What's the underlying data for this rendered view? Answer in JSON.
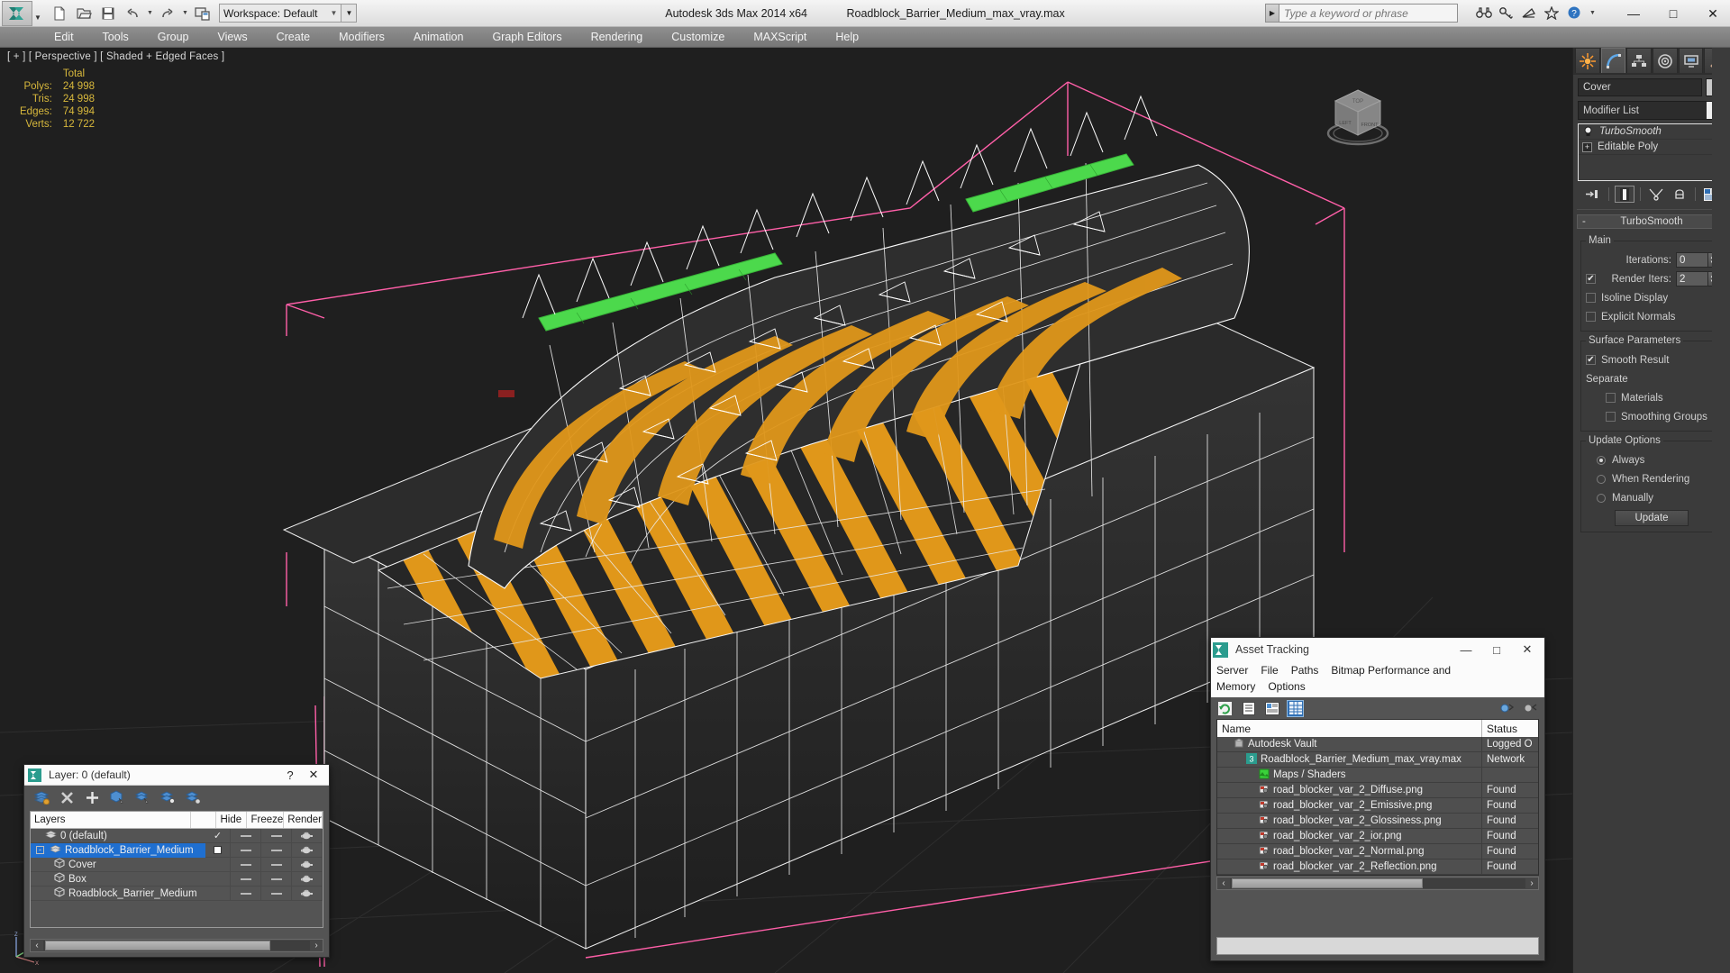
{
  "titlebar": {
    "app_name": "Autodesk 3ds Max  2014 x64",
    "file_name": "Roadblock_Barrier_Medium_max_vray.max",
    "workspace_label": "Workspace: Default",
    "search_placeholder": "Type a keyword or phrase",
    "minimize": "—",
    "maximize": "□",
    "close": "✕",
    "quick_access": [
      {
        "name": "new-scene-icon"
      },
      {
        "name": "open-file-icon"
      },
      {
        "name": "save-file-icon"
      },
      {
        "name": "undo-icon"
      },
      {
        "name": "redo-icon"
      },
      {
        "name": "project-folder-icon"
      }
    ],
    "help_icons": [
      {
        "name": "binoculars-icon"
      },
      {
        "name": "key-icon"
      },
      {
        "name": "satellite-dish-icon"
      },
      {
        "name": "star-icon"
      },
      {
        "name": "help-icon"
      }
    ]
  },
  "menu": {
    "items": [
      "Edit",
      "Tools",
      "Group",
      "Views",
      "Create",
      "Modifiers",
      "Animation",
      "Graph Editors",
      "Rendering",
      "Customize",
      "MAXScript",
      "Help"
    ]
  },
  "viewport": {
    "label": "[ + ] [ Perspective ] [ Shaded + Edged Faces ]",
    "stats_header": "Total",
    "stats": [
      {
        "label": "Polys:",
        "value": "24 998"
      },
      {
        "label": "Tris:",
        "value": "24 998"
      },
      {
        "label": "Edges:",
        "value": "74 994"
      },
      {
        "label": "Verts:",
        "value": "12 722"
      }
    ],
    "viewcube_faces": [
      "TOP",
      "LEFT",
      "FRONT"
    ],
    "colors": {
      "background": "#1f1f1f",
      "selection_bracket": "#ff5fa8",
      "wireframe": "#ffffff",
      "stripe_yellow": "#e8a317",
      "body_dark": "#2b2b2b",
      "emissive_green": "#4cd94c",
      "stats_text": "#d8b83c"
    }
  },
  "command_panel": {
    "tabs": [
      {
        "name": "create-tab",
        "icon": "star-burst-icon",
        "active": false
      },
      {
        "name": "modify-tab",
        "icon": "curve-icon",
        "active": true
      },
      {
        "name": "hierarchy-tab",
        "icon": "hierarchy-icon",
        "active": false
      },
      {
        "name": "motion-tab",
        "icon": "motion-wheel-icon",
        "active": false
      },
      {
        "name": "display-tab",
        "icon": "display-monitor-icon",
        "active": false
      },
      {
        "name": "utilities-tab",
        "icon": "hammer-icon",
        "active": false
      }
    ],
    "object_name": "Cover",
    "modifier_list_label": "Modifier List",
    "stack": [
      {
        "label": "TurboSmooth",
        "selected": true
      },
      {
        "label": "Editable Poly",
        "selected": false
      }
    ],
    "stack_tools": [
      {
        "name": "pin-stack-icon"
      },
      {
        "name": "show-end-result-icon"
      },
      {
        "name": "make-unique-icon"
      },
      {
        "name": "remove-modifier-icon"
      },
      {
        "name": "configure-modifier-sets-icon"
      }
    ],
    "turbosmooth": {
      "title": "TurboSmooth",
      "collapse_glyph": "-",
      "main_group": "Main",
      "iterations_label": "Iterations:",
      "iterations_value": "0",
      "render_iters_label": "Render Iters:",
      "render_iters_value": "2",
      "render_iters_checked": true,
      "isoline_label": "Isoline Display",
      "isoline_checked": false,
      "explicit_normals_label": "Explicit Normals",
      "explicit_normals_checked": false,
      "surface_group": "Surface Parameters",
      "smooth_result_label": "Smooth Result",
      "smooth_result_checked": true,
      "separate_label": "Separate",
      "materials_label": "Materials",
      "materials_checked": false,
      "smoothing_groups_label": "Smoothing Groups",
      "smoothing_groups_checked": false,
      "update_group": "Update Options",
      "always_label": "Always",
      "when_rendering_label": "When Rendering",
      "manually_label": "Manually",
      "update_mode": "Always",
      "update_button": "Update"
    }
  },
  "layer_dialog": {
    "title": "Layer: 0 (default)",
    "help_glyph": "?",
    "close_glyph": "✕",
    "toolbar": [
      {
        "name": "create-new-layer-icon"
      },
      {
        "name": "delete-layer-icon"
      },
      {
        "name": "add-selection-to-layer-icon"
      },
      {
        "name": "select-objects-in-layer-icon"
      },
      {
        "name": "highlight-selected-objects-icon"
      },
      {
        "name": "select-highlighted-objects-icon"
      },
      {
        "name": "layer-properties-icon"
      }
    ],
    "columns": [
      "Layers",
      "",
      "Hide",
      "Freeze",
      "Render"
    ],
    "rows": [
      {
        "name": "0 (default)",
        "indent": 1,
        "type": "layer",
        "active": true,
        "selected": false,
        "expander": ""
      },
      {
        "name": "Roadblock_Barrier_Medium",
        "indent": 0,
        "type": "layer",
        "active": false,
        "selected": true,
        "expander": "-"
      },
      {
        "name": "Cover",
        "indent": 2,
        "type": "object",
        "active": false,
        "selected": false,
        "expander": ""
      },
      {
        "name": "Box",
        "indent": 2,
        "type": "object",
        "active": false,
        "selected": false,
        "expander": ""
      },
      {
        "name": "Roadblock_Barrier_Medium",
        "indent": 2,
        "type": "object",
        "active": false,
        "selected": false,
        "expander": ""
      }
    ]
  },
  "asset_tracking": {
    "title": "Asset Tracking",
    "minimize": "—",
    "maximize": "□",
    "close": "✕",
    "menu": [
      "Server",
      "File",
      "Paths",
      "Bitmap Performance and Memory",
      "Options"
    ],
    "toolbar": [
      {
        "name": "refresh-icon",
        "active": false
      },
      {
        "name": "list-view-icon",
        "active": false
      },
      {
        "name": "detail-view-icon",
        "active": false
      },
      {
        "name": "grid-view-icon",
        "active": true
      },
      {
        "name": "check-in-icon",
        "active": false
      },
      {
        "name": "check-out-icon",
        "active": false
      }
    ],
    "columns": [
      "Name",
      "Status"
    ],
    "rows": [
      {
        "name": "Autodesk Vault",
        "status": "Logged O",
        "indent": 1,
        "icon": "vault-icon"
      },
      {
        "name": "Roadblock_Barrier_Medium_max_vray.max",
        "status": "Network",
        "indent": 2,
        "icon": "max-file-icon"
      },
      {
        "name": "Maps / Shaders",
        "status": "",
        "indent": 3,
        "icon": "maps-shaders-icon"
      },
      {
        "name": "road_blocker_var_2_Diffuse.png",
        "status": "Found",
        "indent": 3,
        "icon": "bitmap-icon"
      },
      {
        "name": "road_blocker_var_2_Emissive.png",
        "status": "Found",
        "indent": 3,
        "icon": "bitmap-icon"
      },
      {
        "name": "road_blocker_var_2_Glossiness.png",
        "status": "Found",
        "indent": 3,
        "icon": "bitmap-icon"
      },
      {
        "name": "road_blocker_var_2_ior.png",
        "status": "Found",
        "indent": 3,
        "icon": "bitmap-icon"
      },
      {
        "name": "road_blocker_var_2_Normal.png",
        "status": "Found",
        "indent": 3,
        "icon": "bitmap-icon"
      },
      {
        "name": "road_blocker_var_2_Reflection.png",
        "status": "Found",
        "indent": 3,
        "icon": "bitmap-icon"
      }
    ],
    "statusbar_text": ""
  }
}
